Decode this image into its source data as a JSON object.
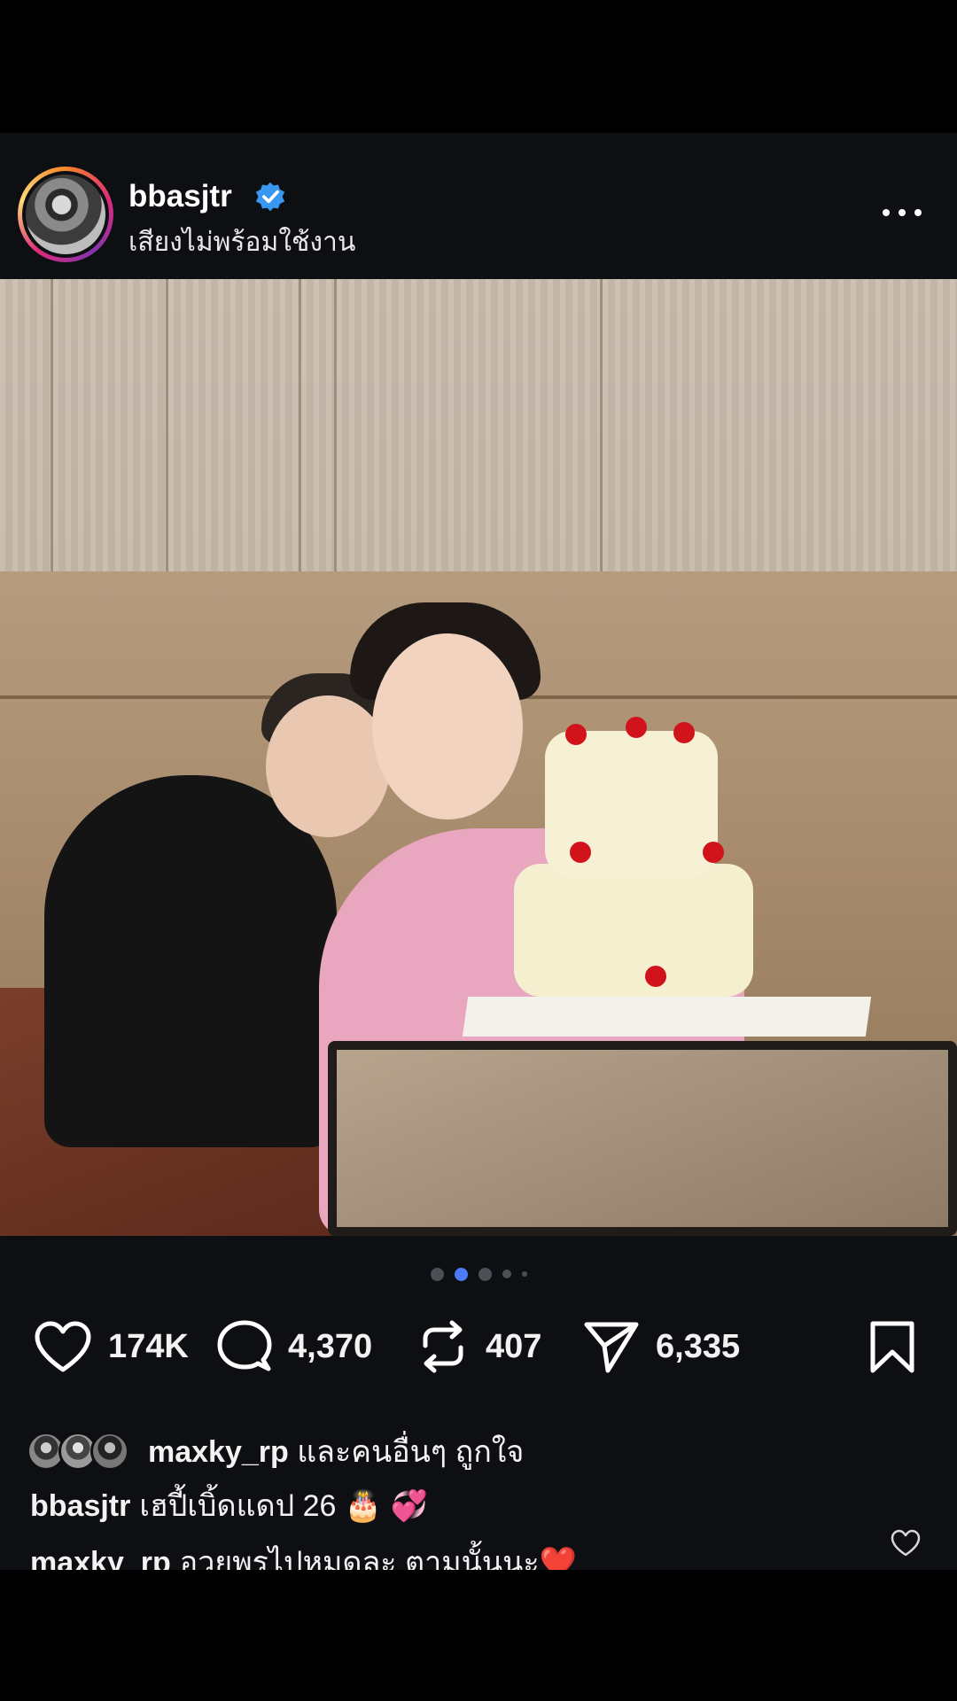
{
  "post": {
    "username": "bbasjtr",
    "verified": true,
    "subtitle": "เสียงไม่พร้อมใช้งาน",
    "carousel": {
      "total": 5,
      "active_index": 1
    },
    "actions": {
      "likes": "174K",
      "comments": "4,370",
      "reposts": "407",
      "shares": "6,335"
    },
    "liked_by": {
      "username": "maxky_rp",
      "suffix": "และคนอื่นๆ ถูกใจ"
    },
    "caption": {
      "username": "bbasjtr",
      "text": "เฮปี้เบิ้ดแดป 26 🎂 💞"
    },
    "top_comment": {
      "username": "maxky_rp",
      "text": "อวยพรไปหมดละ ตามนั้นนะ❤️"
    },
    "icons": [
      "verified-badge-icon",
      "more-icon",
      "mute-icon",
      "heart-icon",
      "comment-icon",
      "repost-icon",
      "share-icon",
      "bookmark-icon"
    ],
    "colors": {
      "background": "#0d0f12",
      "accent": "#4b7cf6",
      "verified": "#3897f0",
      "text": "#f5f5f5"
    }
  }
}
